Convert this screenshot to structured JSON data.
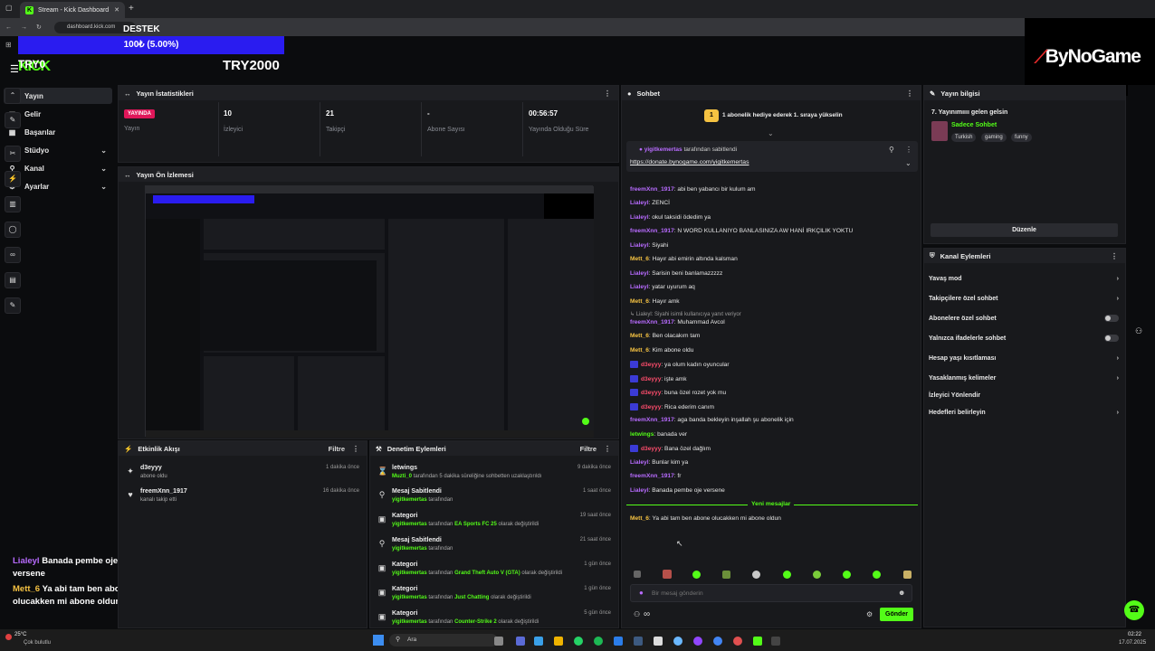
{
  "browser": {
    "tab_title": "Stream - Kick Dashboard",
    "url": "dashboard.kick.com"
  },
  "overlay": {
    "label": "DESTEK",
    "goal_text": "100₺ (5.00%)",
    "goal_progress": 0.05,
    "brand": "ByNoGame",
    "chat": [
      {
        "user": "Lialeyl",
        "text": "Banada pembe oje versene"
      },
      {
        "user": "Mett_6",
        "text": "Ya abi tam ben abone olucakken mi abone oldun"
      }
    ]
  },
  "header": {
    "logo": "KICK",
    "channel_small": "TRY0",
    "channel_big": "TRY2000"
  },
  "sidebar": {
    "items": [
      {
        "label": "Yayın",
        "icon": "broadcast-icon",
        "active": true
      },
      {
        "label": "Gelir",
        "icon": "wallet-icon"
      },
      {
        "label": "Başarılar",
        "icon": "trophy-icon"
      },
      {
        "label": "Stüdyo",
        "icon": "studio-icon",
        "expand": true
      },
      {
        "label": "Kanal",
        "icon": "user-icon",
        "expand": true
      },
      {
        "label": "Ayarlar",
        "icon": "gear-icon",
        "expand": true
      }
    ]
  },
  "stats": {
    "title": "Yayın İstatistikleri",
    "live_badge": "YAYINDA",
    "items": [
      {
        "label": "Yayın",
        "value": ""
      },
      {
        "label": "İzleyici",
        "value": "10"
      },
      {
        "label": "Takipçi",
        "value": "21"
      },
      {
        "label": "Abone Sayısı",
        "value": "-"
      },
      {
        "label": "Yayında Olduğu Süre",
        "value": "00:56:57"
      }
    ]
  },
  "preview": {
    "title": "Yayın Ön İzlemesi"
  },
  "activity": {
    "title": "Etkinlik Akışı",
    "filter_label": "Filtre",
    "items": [
      {
        "user": "d3eyyy",
        "desc": "abone oldu",
        "time": "1 dakika önce"
      },
      {
        "user": "freemXnn_1917",
        "desc": "kanalı takip etti",
        "time": "16 dakika önce"
      }
    ]
  },
  "moderation": {
    "title": "Denetim Eylemleri",
    "filter_label": "Filtre",
    "items": [
      {
        "title": "letwings",
        "who": "Muzti_0",
        "desc": "tarafından 5 dakika süreliğine sohbetten uzaklaştırıldı",
        "time": "9 dakika önce"
      },
      {
        "title": "Mesaj Sabitlendi",
        "who": "yigitkemertas",
        "desc": "tarafından",
        "time": "1 saat önce"
      },
      {
        "title": "Kategori",
        "who": "yigitkemertas",
        "desc": "tarafından",
        "value": "EA Sports FC 25",
        "suffix": "olarak değiştirildi",
        "time": "19 saat önce"
      },
      {
        "title": "Mesaj Sabitlendi",
        "who": "yigitkemertas",
        "desc": "tarafından",
        "time": "21 saat önce"
      },
      {
        "title": "Kategori",
        "who": "yigitkemertas",
        "desc": "tarafından",
        "value": "Grand Theft Auto V (GTA)",
        "suffix": "olarak değiştirildi",
        "time": "1 gün önce"
      },
      {
        "title": "Kategori",
        "who": "yigitkemertas",
        "desc": "tarafından",
        "value": "Just Chatting",
        "suffix": "olarak değiştirildi",
        "time": "1 gün önce"
      },
      {
        "title": "Kategori",
        "who": "yigitkemertas",
        "desc": "tarafından",
        "value": "Counter-Strike 2",
        "suffix": "olarak değiştirildi",
        "time": "5 gün önce"
      }
    ]
  },
  "chat": {
    "title": "Sohbet",
    "gift_banner": "1 abonelik hediye ederek 1. sıraya yükselin",
    "pinned_by": "yigitkemertas",
    "pinned_suffix": "tarafından sabitlendi",
    "pinned_link": "https://donate.bynogame.com/yigitkemertas",
    "messages": [
      {
        "user": "freemXnn_1917",
        "color": "p",
        "text": "abi ben yabancı bir kulum am"
      },
      {
        "user": "Lialeyl",
        "color": "p",
        "text": "ZENCİ"
      },
      {
        "user": "Lialeyl",
        "color": "p",
        "text": "okul taksidi ödedim ya"
      },
      {
        "user": "freemXnn_1917",
        "color": "p",
        "text": "N WORD KULLANIYO BANLASINIZA AW HANİ IRKÇILIK YOKTU"
      },
      {
        "user": "Lialeyl",
        "color": "p",
        "text": "Siyahi"
      },
      {
        "user": "Mett_6",
        "color": "y",
        "text": "Hayır abi emirin altında kalsman"
      },
      {
        "user": "Lialeyl",
        "color": "p",
        "text": "Sarisin beni banlamazzzzz"
      },
      {
        "user": "Lialeyl",
        "color": "p",
        "text": "yatar uyurum aq"
      },
      {
        "user": "Mett_6",
        "color": "y",
        "text": "Hayır amk"
      },
      {
        "user": "freemXnn_1917",
        "color": "p",
        "text": "Muhammad Avcol"
      },
      {
        "user": "Mett_6",
        "color": "y",
        "text": "Ben olacakım tam"
      },
      {
        "user": "Mett_6",
        "color": "y",
        "text": "Kim abone oldu"
      },
      {
        "user": "d3eyyy",
        "color": "r",
        "text": "ya olum kadın oyuncular"
      },
      {
        "user": "d3eyyy",
        "color": "r",
        "text": "işte amk"
      },
      {
        "user": "d3eyyy",
        "color": "r",
        "text": "buna özel rozet yok mu"
      },
      {
        "user": "d3eyyy",
        "color": "r",
        "text": "Rica ederim canım"
      },
      {
        "user": "freemXnn_1917",
        "color": "p",
        "text": "aga banda bekleyin inşallah şu abonelik için"
      },
      {
        "user": "letwings",
        "color": "g",
        "text": "banada ver"
      },
      {
        "user": "d3eyyy",
        "color": "r",
        "text": "Bana özel dağlım"
      },
      {
        "user": "Lialeyl",
        "color": "p",
        "text": "Bunlar kim ya"
      },
      {
        "user": "freemXnn_1917",
        "color": "p",
        "text": "fr"
      },
      {
        "user": "Lialeyl",
        "color": "p",
        "text": "Banada pembe oje versene"
      }
    ],
    "reply_note": "Lialeyl: Siyahi isimli kullanıcıya yanıt veriyor",
    "new_messages": "Yeni mesajlar",
    "latest": {
      "user": "Mett_6",
      "text": "Ya abi tam ben abone olucakken mi abone oldun"
    },
    "input_placeholder": "Bir mesaj gönderin",
    "send_label": "Gönder",
    "infinity": "∞"
  },
  "stream_info": {
    "title": "Yayın bilgisi",
    "stream_title": "7. Yayınımıııı gelen gelsin",
    "category": "Sadece Sohbet",
    "tags": [
      "Turkish",
      "gaming",
      "funny"
    ],
    "edit_label": "Düzenle"
  },
  "channel_actions": {
    "title": "Kanal Eylemleri",
    "items": [
      {
        "label": "Yavaş mod",
        "type": "chevron"
      },
      {
        "label": "Takipçilere özel sohbet",
        "type": "chevron"
      },
      {
        "label": "Abonelere özel sohbet",
        "type": "toggle"
      },
      {
        "label": "Yalnızca ifadelerle sohbet",
        "type": "toggle"
      },
      {
        "label": "Hesap yaşı kısıtlaması",
        "type": "chevron"
      },
      {
        "label": "Yasaklanmış kelimeler",
        "type": "chevron"
      },
      {
        "label": "İzleyici Yönlendir",
        "type": "none"
      },
      {
        "label": "Hedefleri belirleyin",
        "type": "chevron"
      }
    ]
  },
  "taskbar": {
    "weather": "25°C",
    "weather_desc": "Çok bulutlu",
    "search": "Ara",
    "time": "02:22",
    "date": "17.07.2025"
  },
  "colors": {
    "kick_green": "#53fc18",
    "panel": "#18191c",
    "live_pink": "#e0175a",
    "goal_blue": "#2a1cf0"
  }
}
